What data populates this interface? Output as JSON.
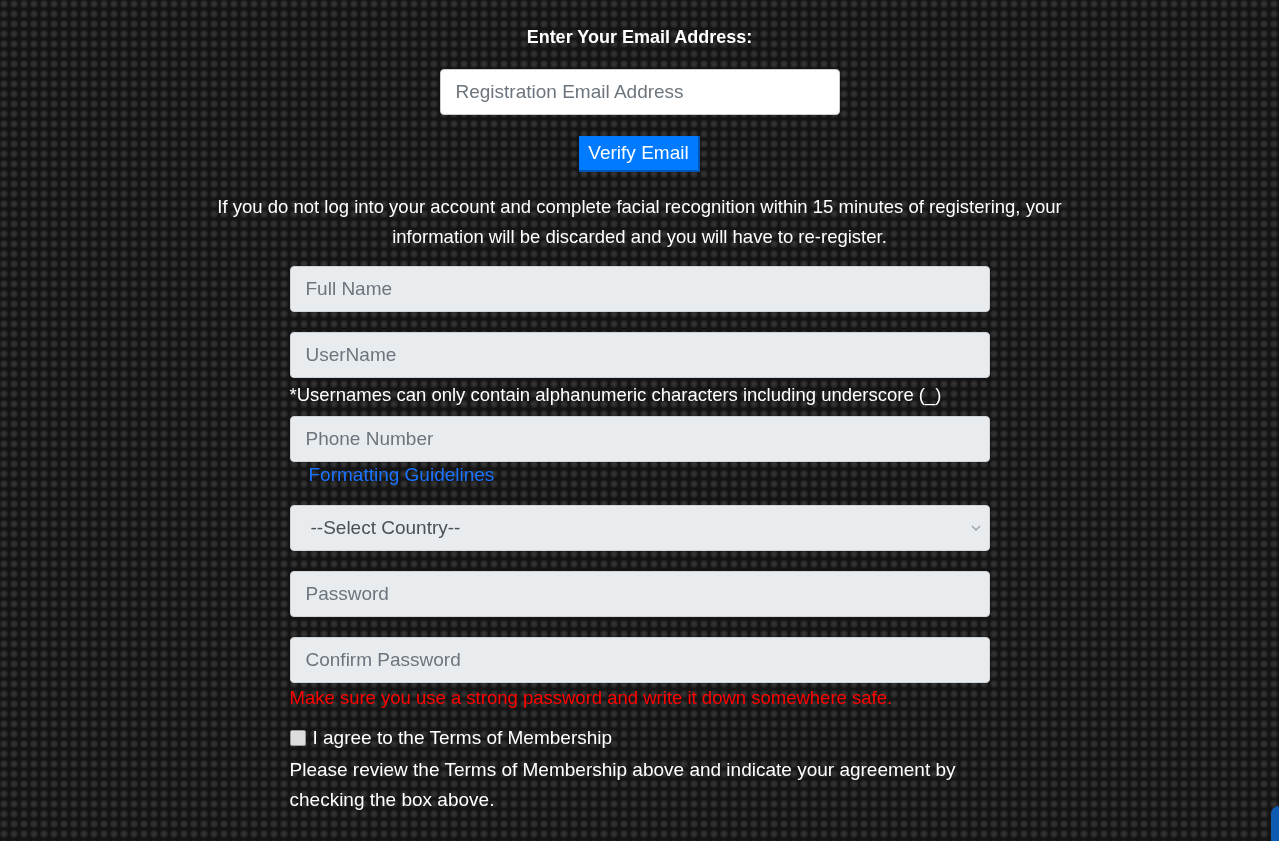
{
  "email_section": {
    "heading": "Enter Your Email Address:",
    "email_field": {
      "placeholder": "Registration Email Address"
    },
    "verify_button": "Verify Email"
  },
  "notice": "If you do not log into your account and complete facial recognition within 15 minutes of registering, your information will be discarded and you will have to re-register.",
  "form": {
    "fields": [
      {
        "kind": "input",
        "placeholder": "Full Name"
      },
      {
        "kind": "input",
        "placeholder": "UserName",
        "note": "*Usernames can only contain alphanumeric characters including underscore (_)"
      },
      {
        "kind": "input",
        "placeholder": "Phone Number",
        "link": "Formatting Guidelines"
      },
      {
        "kind": "select",
        "value": "--Select Country--"
      },
      {
        "kind": "password",
        "placeholder": "Password"
      },
      {
        "kind": "password",
        "placeholder": "Confirm Password",
        "warning": "Make sure you use a strong password and write it down somewhere safe."
      }
    ],
    "terms": {
      "label": "I agree to the Terms of Membership",
      "checked": false,
      "help": "Please review the Terms of Membership above and indicate your agreement by checking the box above."
    }
  }
}
